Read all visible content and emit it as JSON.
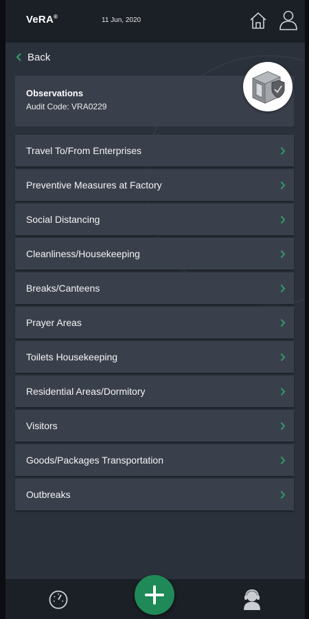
{
  "header": {
    "brand": "VeRA",
    "brand_mark": "®",
    "date": "11 Jun, 2020",
    "icons": [
      "home-icon",
      "user-icon"
    ]
  },
  "nav": {
    "back_label": "Back"
  },
  "card": {
    "title": "Observations",
    "audit_code": "Audit Code: VRA0229"
  },
  "menu": {
    "items": [
      {
        "label": "Travel To/From Enterprises"
      },
      {
        "label": "Preventive Measures at Factory"
      },
      {
        "label": "Social Distancing"
      },
      {
        "label": "Cleanliness/Housekeeping"
      },
      {
        "label": "Breaks/Canteens"
      },
      {
        "label": "Prayer Areas"
      },
      {
        "label": "Toilets Housekeeping"
      },
      {
        "label": "Residential Areas/Dormitory"
      },
      {
        "label": "Visitors"
      },
      {
        "label": "Goods/Packages Transportation"
      },
      {
        "label": "Outbreaks"
      }
    ]
  },
  "bottom_nav": {
    "icons": [
      "gauge-icon",
      "add-icon",
      "support-icon"
    ]
  },
  "colors": {
    "accent": "#1f8a57",
    "background": "#2b313b",
    "card": "#3a404b",
    "bar": "#1b1f26"
  }
}
